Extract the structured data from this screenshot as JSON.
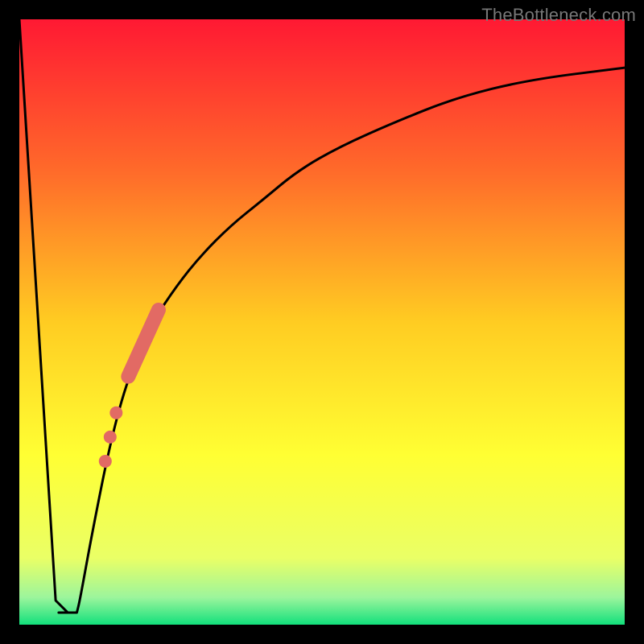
{
  "domain": "Chart",
  "watermark": "TheBottleneck.com",
  "chart_data": {
    "type": "line",
    "title": "",
    "xlabel": "",
    "ylabel": "",
    "xlim": [
      0,
      100
    ],
    "ylim": [
      0,
      100
    ],
    "background": {
      "style": "vertical-gradient",
      "stops": [
        {
          "pos": 0.0,
          "color": "#ff1933"
        },
        {
          "pos": 0.25,
          "color": "#ff6a2a"
        },
        {
          "pos": 0.5,
          "color": "#ffcc22"
        },
        {
          "pos": 0.72,
          "color": "#ffff33"
        },
        {
          "pos": 0.89,
          "color": "#eaff66"
        },
        {
          "pos": 0.955,
          "color": "#9cf59c"
        },
        {
          "pos": 1.0,
          "color": "#12e07c"
        }
      ]
    },
    "series": [
      {
        "name": "bottleneck-curve",
        "type": "line",
        "x": [
          0,
          6.0,
          8.0,
          10.0,
          12,
          15,
          18,
          22,
          26,
          30,
          35,
          40,
          46,
          53,
          62,
          72,
          84,
          100
        ],
        "y": [
          100,
          4,
          2,
          4,
          15,
          30,
          41,
          50,
          56,
          61,
          66,
          70,
          75,
          79,
          83,
          87,
          90,
          92
        ]
      },
      {
        "name": "flat-floor",
        "type": "line",
        "x": [
          6.5,
          9.5
        ],
        "y": [
          2,
          2
        ]
      }
    ],
    "highlights": {
      "thick_segment": {
        "x": [
          18,
          23
        ],
        "y": [
          41,
          52
        ]
      },
      "dots": [
        {
          "x": 16.0,
          "y": 35
        },
        {
          "x": 15.0,
          "y": 31
        },
        {
          "x": 14.2,
          "y": 27
        }
      ],
      "color": "#e26a64"
    },
    "frame": {
      "outer_border_px": 24,
      "color": "#000000"
    }
  }
}
